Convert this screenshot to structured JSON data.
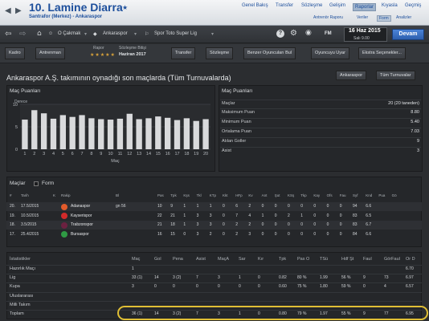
{
  "header": {
    "player_name": "10. Lamine Diarra",
    "player_sub": "Santrafor (Merkez) - Ankaraspor",
    "nav_main": [
      "Genel Bakış",
      "Transfer",
      "Sözleşme",
      "Gelişim",
      "Raporlar",
      "Kıyasla",
      "Geçmiş"
    ],
    "nav_sub": [
      "Antrenör Raporu",
      "Veriler",
      "Form",
      "Analizler"
    ]
  },
  "toolbar": {
    "manager": "O Çakmak",
    "club": "Ankaraspor",
    "league": "Spor Toto Super Lig",
    "fm_label": "FM",
    "date_main": "16 Haz 2015",
    "date_sub": "Salı 9.00",
    "continue_label": "Devam"
  },
  "subbar": {
    "squad": "Kadro",
    "training": "Antrenman",
    "report_label": "Rapor",
    "contract_end_label": "Sözleşme Bitişi",
    "contract_end_value": "Haziran 2017",
    "transfer": "Transfer",
    "contract": "Sözleşme",
    "similar": "Benzer Oyuncuları Bul",
    "player_warn": "Oyuncuyu Uyar",
    "extra": "Ekstra Seçenekler..."
  },
  "page": {
    "title": "Ankaraspor A.Ş. takımının oynadığı son maçlarda (Tüm Turnuvalarda)",
    "club_filter": "Ankaraspor",
    "comp_filter": "Tüm Turnuvalar"
  },
  "chart_panel": {
    "title": "Maç Puanları",
    "ylabel": "Derece",
    "xlabel": "Maç"
  },
  "chart_data": {
    "type": "bar",
    "categories": [
      "1",
      "2",
      "3",
      "4",
      "5",
      "6",
      "7",
      "8",
      "9",
      "10",
      "11",
      "12",
      "13",
      "14",
      "15",
      "16",
      "17",
      "18",
      "19",
      "20"
    ],
    "values": [
      6.6,
      8.7,
      8.0,
      6.8,
      7.6,
      7.2,
      7.6,
      6.9,
      6.7,
      6.6,
      6.8,
      7.9,
      6.7,
      6.9,
      7.3,
      7.0,
      6.5,
      6.9,
      6.3,
      6.7
    ],
    "ylabel": "Derece",
    "xlabel": "Maç",
    "ylim": [
      0,
      10
    ],
    "yticks": [
      0,
      5,
      10
    ],
    "bar_color": "#d9dadc"
  },
  "ratings_panel": {
    "title": "Maç Puanları",
    "rows": [
      {
        "label": "Maçlar",
        "value": "20 (20 taneden)"
      },
      {
        "label": "Maksimum Puan",
        "value": "8.80"
      },
      {
        "label": "Minimum Puan",
        "value": "5.40"
      },
      {
        "label": "Ortalama Puan",
        "value": "7.03"
      },
      {
        "label": "Atılan Goller",
        "value": "9"
      },
      {
        "label": "Asist",
        "value": "3"
      }
    ]
  },
  "matches": {
    "tab_matches": "Maçlar",
    "tab_form": "Form",
    "headers": [
      "#",
      "Tarih",
      "K",
      "Rakip",
      "Bl",
      "Pas",
      "Tpk",
      "Kşs",
      "Tkl",
      "KTp",
      "Kkt",
      "HFp",
      "Kv",
      "Ant",
      "Şut",
      "KSş",
      "Tkp",
      "Kay",
      "Ofs",
      "Fau",
      "Syf",
      "Knd",
      "Pua",
      "Gö"
    ],
    "rows": [
      {
        "no": "20.",
        "date": "17.5/2015",
        "opp": "Adanaspor",
        "color": "#e25b2b",
        "result": "gn 56",
        "cells": [
          "10",
          "9",
          "1",
          "1",
          "1",
          "0",
          "6",
          "2",
          "0",
          "0",
          "0",
          "0",
          "0",
          "0",
          "0",
          "94",
          "6.6"
        ]
      },
      {
        "no": "19.",
        "date": "10.5/2015",
        "opp": "Kayserispor",
        "color": "#d12a2a",
        "result": "",
        "cells": [
          "22",
          "21",
          "1",
          "3",
          "3",
          "0",
          "7",
          "4",
          "1",
          "0",
          "2",
          "1",
          "0",
          "0",
          "0",
          "83",
          "6.5"
        ]
      },
      {
        "no": "18.",
        "date": "3.5/2015",
        "opp": "Trabzonspor",
        "color": "#6b2140",
        "result": "",
        "cells": [
          "21",
          "18",
          "1",
          "3",
          "3",
          "0",
          "2",
          "2",
          "0",
          "0",
          "0",
          "0",
          "0",
          "0",
          "0",
          "83",
          "6.7"
        ]
      },
      {
        "no": "17.",
        "date": "25.4/2015",
        "opp": "Bursaspor",
        "color": "#2f9a44",
        "result": "",
        "cells": [
          "16",
          "15",
          "0",
          "3",
          "2",
          "0",
          "2",
          "3",
          "0",
          "0",
          "0",
          "0",
          "0",
          "0",
          "0",
          "84",
          "6.6"
        ]
      }
    ]
  },
  "stats": {
    "headers": [
      "İstatistikler",
      "Maç",
      "Gol",
      "Pena",
      "Asist",
      "MaçA",
      "Sar",
      "Kır",
      "Tpk",
      "Pas O",
      "TSü",
      "Hdf Şt",
      "Faul",
      "GörFaul",
      "Or D"
    ],
    "rows": [
      {
        "label": "Hazırlık Maçı",
        "cells": [
          "1",
          "",
          "",
          "",
          "",
          "",
          "",
          "",
          "",
          "",
          "",
          "",
          "",
          "6.70"
        ]
      },
      {
        "label": "Lig",
        "cells": [
          "33 (1)",
          "14",
          "3 (2)",
          "7",
          "3",
          "1",
          "0",
          "0.82",
          "80 %",
          "1.99",
          "56 %",
          "9",
          "73",
          "6.97"
        ]
      },
      {
        "label": "Kupa",
        "cells": [
          "3",
          "0",
          "0",
          "0",
          "0",
          "0",
          "0",
          "0.60",
          "75 %",
          "1.80",
          "59 %",
          "0",
          "4",
          "6.57"
        ]
      },
      {
        "label": "Uluslararası",
        "cells": [
          "",
          "",
          "",
          "",
          "",
          "",
          "",
          "",
          "",
          "",
          "",
          "",
          "",
          ""
        ]
      },
      {
        "label": "Milli Takım",
        "cells": [
          "",
          "",
          "",
          "",
          "",
          "",
          "",
          "",
          "",
          "",
          "",
          "",
          "",
          ""
        ]
      },
      {
        "label": "Toplam",
        "cells": [
          "36 (1)",
          "14",
          "3 (2)",
          "7",
          "3",
          "1",
          "0",
          "0.80",
          "79 %",
          "1.97",
          "55 %",
          "9",
          "77",
          "6.95"
        ]
      }
    ]
  }
}
